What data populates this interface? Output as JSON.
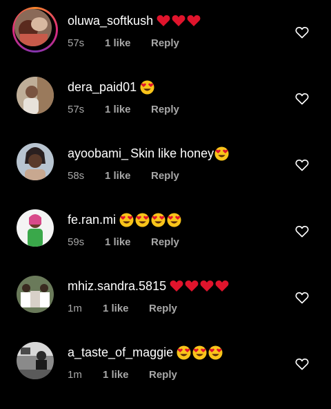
{
  "comments": [
    {
      "username": "oluwa_softkush",
      "text": "",
      "emoji": [
        "heart",
        "heart",
        "heart"
      ],
      "time": "57s",
      "likes": "1 like",
      "reply": "Reply",
      "story_ring": true
    },
    {
      "username": "dera_paid01",
      "text": "",
      "emoji": [
        "heart-eyes"
      ],
      "time": "57s",
      "likes": "1 like",
      "reply": "Reply",
      "story_ring": false
    },
    {
      "username": "ayoobami_",
      "text": "Skin like honey",
      "emoji": [
        "heart-eyes"
      ],
      "time": "58s",
      "likes": "1 like",
      "reply": "Reply",
      "story_ring": false
    },
    {
      "username": "fe.ran.mi",
      "text": "",
      "emoji": [
        "heart-eyes",
        "heart-eyes",
        "heart-eyes",
        "heart-eyes"
      ],
      "time": "59s",
      "likes": "1 like",
      "reply": "Reply",
      "story_ring": false
    },
    {
      "username": "mhiz.sandra.5815",
      "text": "",
      "emoji": [
        "heart",
        "heart",
        "heart",
        "heart"
      ],
      "time": "1m",
      "likes": "1 like",
      "reply": "Reply",
      "story_ring": false
    },
    {
      "username": "a_taste_of_maggie",
      "text": "",
      "emoji": [
        "heart-eyes",
        "heart-eyes",
        "heart-eyes"
      ],
      "time": "1m",
      "likes": "1 like",
      "reply": "Reply",
      "story_ring": false
    }
  ],
  "colors": {
    "background": "#000000",
    "text": "#ffffff",
    "secondary": "#a8a8a8",
    "heart_emoji": "#e0142c",
    "face_emoji": "#f9c41a"
  },
  "icons": {
    "like": "heart-outline-icon",
    "avatar": "profile-avatar-icon"
  }
}
